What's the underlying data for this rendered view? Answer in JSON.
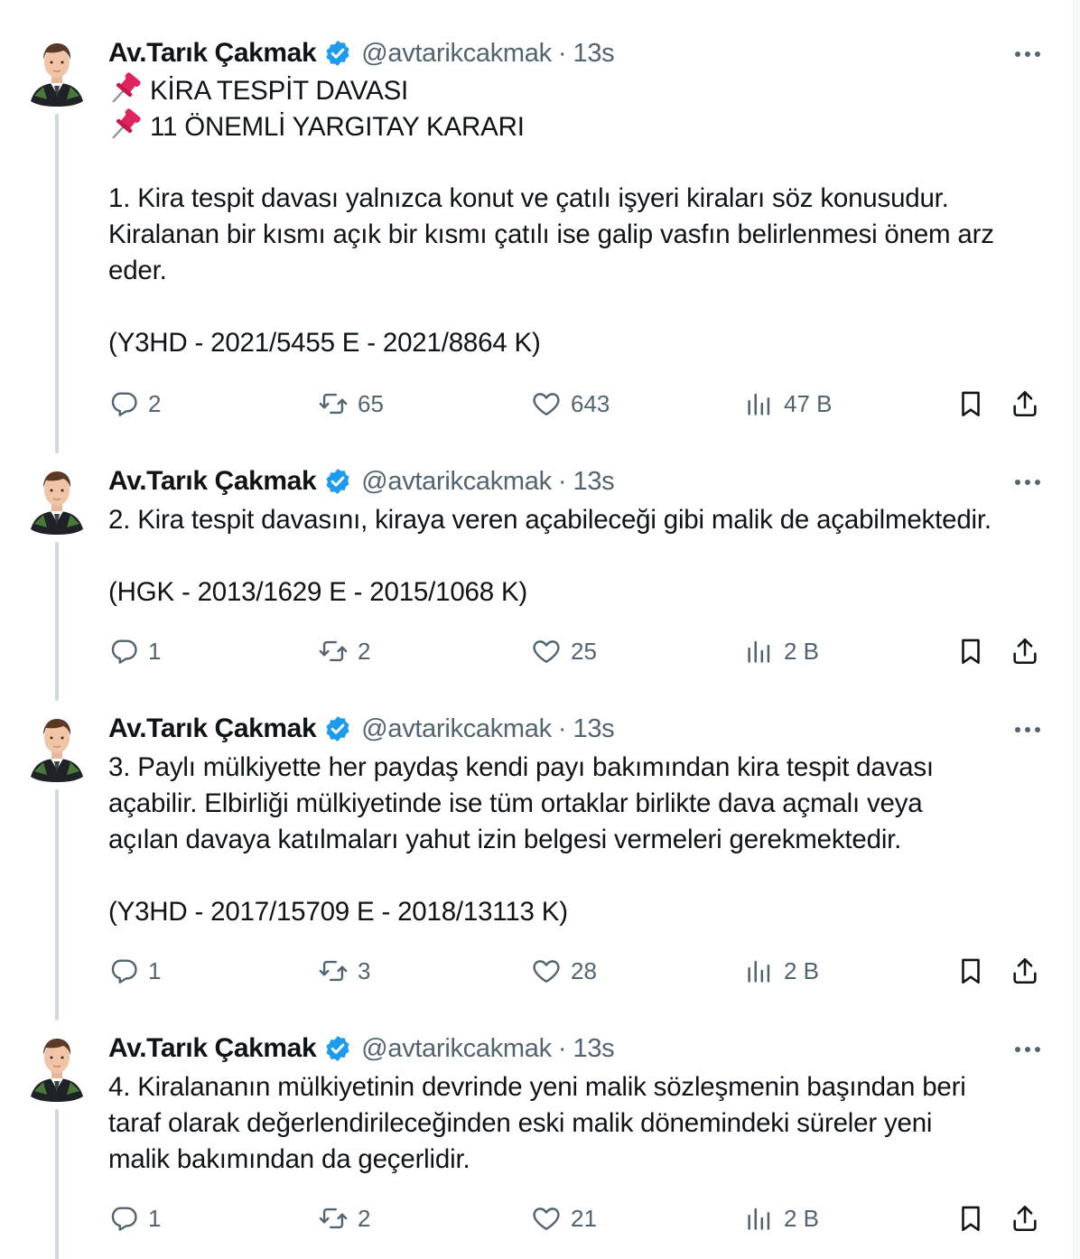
{
  "author": {
    "name": "Av.Tarık Çakmak",
    "handle": "@avtarikcakmak",
    "separator": "·"
  },
  "colors": {
    "verified_badge": "#1d9bf0",
    "secondary_text": "#536471",
    "thread_line": "#cfd9de",
    "pin": "#e0245e"
  },
  "tweets": [
    {
      "time": "13s",
      "heading_lines": [
        "KİRA TESPİT DAVASI",
        "11 ÖNEMLİ YARGITAY KARARI"
      ],
      "lines": [
        "1. Kira tespit davası yalnızca konut ve çatılı işyeri kiraları söz konusudur.",
        "Kiralanan bir kısmı açık bir kısmı çatılı ise galip vasfın belirlenmesi önem arz",
        "eder.",
        "(Y3HD - 2021/5455 E - 2021/8864 K)"
      ],
      "replies": "2",
      "retweets": "65",
      "likes": "643",
      "views": "47 B"
    },
    {
      "time": "13s",
      "lines": [
        "2. Kira tespit davasını, kiraya veren açabileceği gibi malik de açabilmektedir.",
        "(HGK - 2013/1629 E - 2015/1068 K)"
      ],
      "replies": "1",
      "retweets": "2",
      "likes": "25",
      "views": "2 B"
    },
    {
      "time": "13s",
      "lines": [
        "3. Paylı mülkiyette her paydaş kendi payı bakımından kira tespit davası",
        "açabilir. Elbirliği mülkiyetinde ise tüm ortaklar birlikte dava açmalı veya",
        "açılan davaya katılmaları yahut izin belgesi vermeleri gerekmektedir.",
        "(Y3HD - 2017/15709 E - 2018/13113 K)"
      ],
      "replies": "1",
      "retweets": "3",
      "likes": "28",
      "views": "2 B"
    },
    {
      "time": "13s",
      "lines": [
        "4. Kiralananın mülkiyetinin devrinde yeni malik sözleşmenin başından beri",
        "taraf olarak değerlendirileceğinden eski malik dönemindeki süreler yeni",
        "malik bakımından da geçerlidir."
      ],
      "replies": "1",
      "retweets": "2",
      "likes": "21",
      "views": "2 B"
    }
  ]
}
